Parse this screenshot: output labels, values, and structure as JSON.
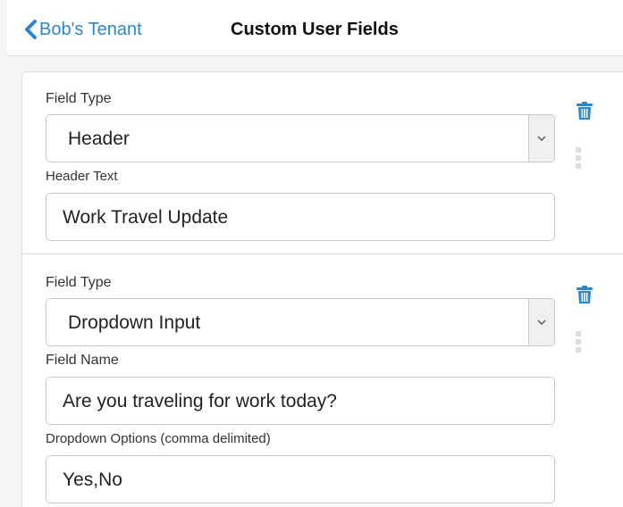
{
  "header": {
    "back_label": "Bob's Tenant",
    "title": "Custom User Fields"
  },
  "fields": [
    {
      "type_label": "Field Type",
      "type_value": "Header",
      "text_label": "Header Text",
      "text_value": "Work Travel Update"
    },
    {
      "type_label": "Field Type",
      "type_value": "Dropdown Input",
      "name_label": "Field Name",
      "name_value": "Are you traveling for work today?",
      "options_label": "Dropdown Options (comma delimited)",
      "options_value": "Yes,No"
    }
  ],
  "icons": {
    "back": "chevron-left-icon",
    "delete": "trash-icon",
    "drag": "drag-handle-icon",
    "select_arrow": "chevron-down-icon"
  },
  "colors": {
    "accent": "#2e86c9",
    "title": "#111111",
    "border": "#c8c8c8"
  }
}
